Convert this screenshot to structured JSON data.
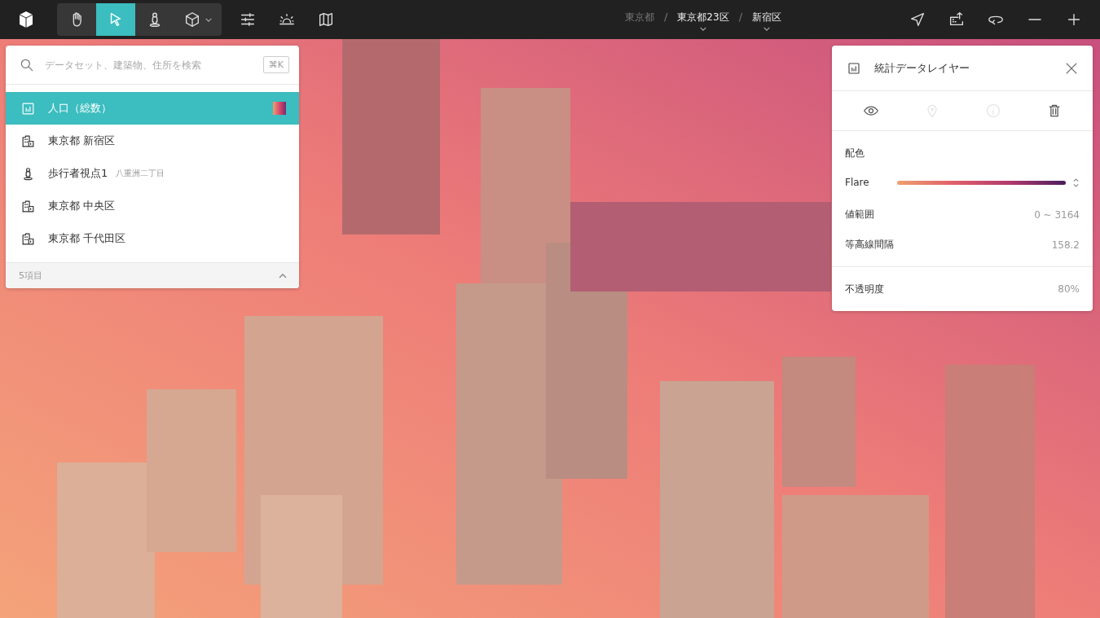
{
  "toolbar": {
    "tools": [
      {
        "kind": "hand",
        "selected": false
      },
      {
        "kind": "pointer",
        "selected": true
      },
      {
        "kind": "pedestrian",
        "selected": false
      },
      {
        "kind": "cube",
        "selected": false
      }
    ],
    "actions": [
      {
        "kind": "sliders"
      },
      {
        "kind": "sun"
      },
      {
        "kind": "map"
      }
    ]
  },
  "breadcrumb": [
    {
      "label": "東京都",
      "dropdown": false
    },
    {
      "separator": "/",
      "label": "東京都23区",
      "dropdown": true
    },
    {
      "separator": "/",
      "label": "新宿区",
      "dropdown": true
    }
  ],
  "view_controls": [
    {
      "kind": "locate"
    },
    {
      "kind": "export"
    },
    {
      "kind": "rotate"
    },
    {
      "kind": "zoom-out"
    },
    {
      "kind": "zoom-in"
    }
  ],
  "search": {
    "placeholder": "データセット、建築物、住所を検索",
    "shortcut": "⌘K"
  },
  "layers": [
    {
      "kind": "stat",
      "label": "人口（総数）",
      "selected": true
    },
    {
      "kind": "area",
      "label": "東京都 新宿区",
      "selected": false
    },
    {
      "kind": "viewpoint",
      "label": "歩行者視点1",
      "sublabel": "八重洲二丁目",
      "selected": false
    },
    {
      "kind": "area",
      "label": "東京都 中央区",
      "selected": false
    },
    {
      "kind": "area",
      "label": "東京都 千代田区",
      "selected": false
    }
  ],
  "layer_count": "5項目",
  "inspector": {
    "title": "統計データレイヤー",
    "actions": [
      {
        "kind": "eye",
        "disabled": false
      },
      {
        "kind": "pin",
        "disabled": true
      },
      {
        "kind": "info",
        "disabled": true
      },
      {
        "kind": "trash",
        "disabled": false
      }
    ],
    "color_heading": "配色",
    "scheme": "Flare",
    "rows": [
      {
        "label": "値範囲",
        "value": "0 ~ 3164"
      },
      {
        "label": "等高線間隔",
        "value": "158.2"
      }
    ],
    "opacity": {
      "label": "不透明度",
      "value": "80%"
    }
  }
}
